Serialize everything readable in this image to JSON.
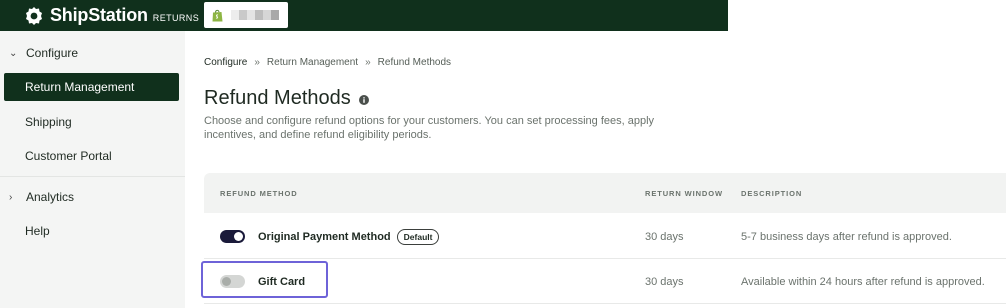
{
  "app": {
    "brand": "ShipStation",
    "brand_sub": "RETURNS",
    "colors": {
      "topbar": "#10301c",
      "active_nav": "#10301c",
      "focus": "#6e63d8"
    }
  },
  "sidebar": {
    "configure": {
      "label": "Configure",
      "icon": "chevron-down-icon"
    },
    "items": [
      {
        "label": "Return Management",
        "active": true
      },
      {
        "label": "Shipping"
      },
      {
        "label": "Customer Portal"
      }
    ],
    "analytics": {
      "label": "Analytics",
      "icon": "chevron-right-icon"
    },
    "help": {
      "label": "Help"
    }
  },
  "breadcrumb": [
    "Configure",
    "Return Management",
    "Refund Methods"
  ],
  "page": {
    "title": "Refund Methods",
    "description": "Choose and configure refund options for your customers. You can set processing fees, apply incentives, and define refund eligibility periods."
  },
  "table": {
    "headers": [
      "REFUND METHOD",
      "RETURN WINDOW",
      "DESCRIPTION"
    ],
    "rows": [
      {
        "method": "Original Payment Method",
        "badge": "Default",
        "enabled": true,
        "window": "30 days",
        "description": "5-7 business days after refund is approved."
      },
      {
        "method": "Gift Card",
        "enabled": false,
        "window": "30 days",
        "description": "Available within 24 hours after refund is approved."
      }
    ]
  }
}
